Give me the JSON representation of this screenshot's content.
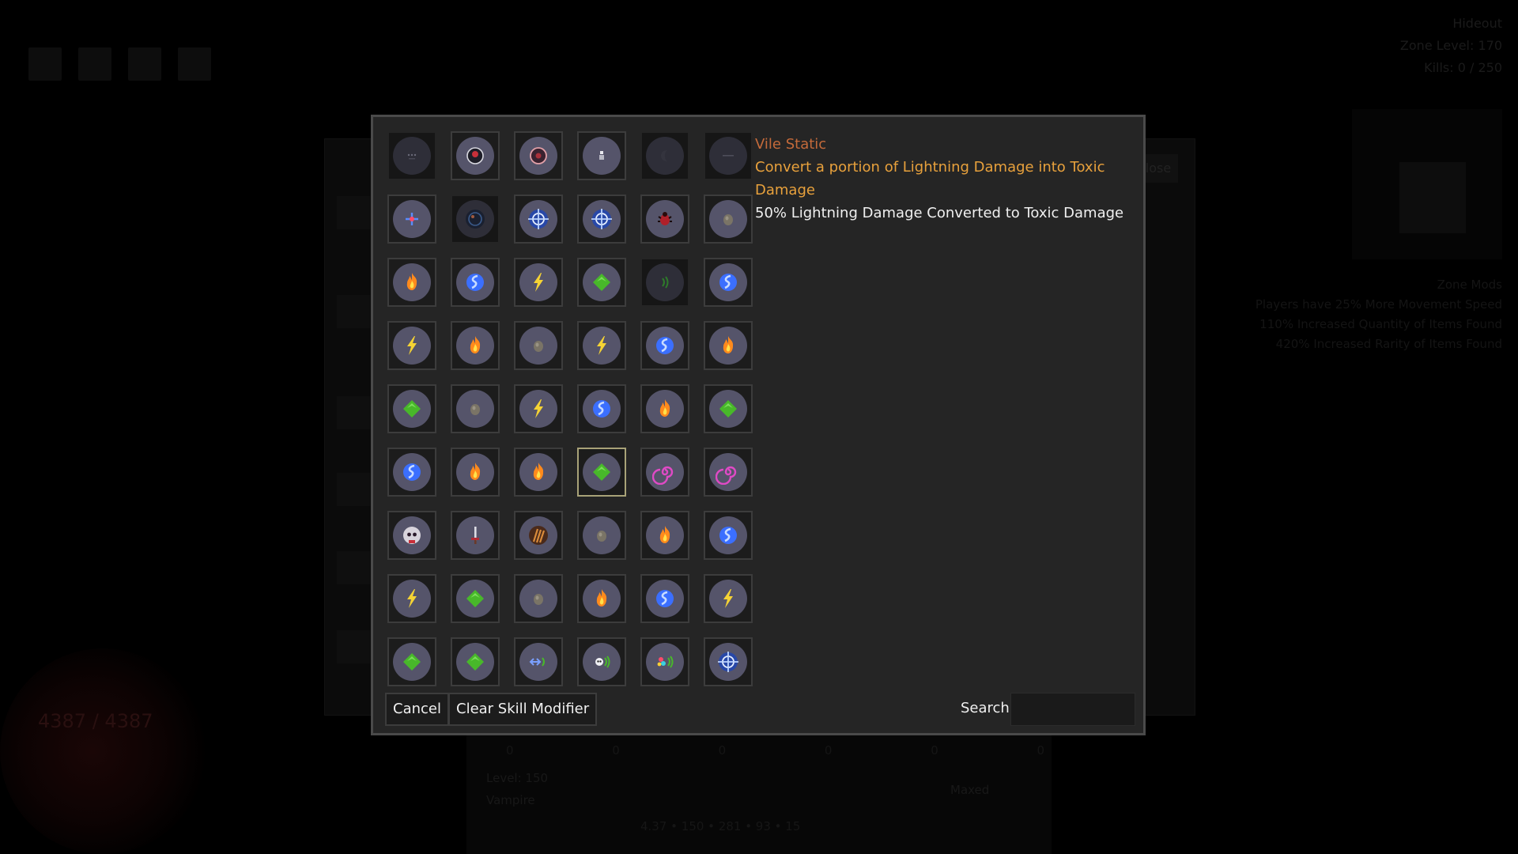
{
  "background": {
    "zone": {
      "name": "Hideout",
      "level": "Zone Level: 170",
      "kills": "Kills: 0 / 250"
    },
    "zone_mods": {
      "title": "Zone Mods",
      "lines": [
        "Players have 25% More Movement Speed",
        "110% Increased Quantity of Items Found",
        "420% Increased Rarity of Items Found"
      ]
    },
    "close_label": "lose",
    "health": "4387 / 4387",
    "bottom_values": "0 0 0 0 0 0",
    "level": "Level: 150",
    "class": "Vampire",
    "maxed": "Maxed",
    "stats": "4.37 • 150 • 281 • 93 • 15"
  },
  "tooltip": {
    "name": "Vile Static",
    "description": "Convert a portion of Lightning Damage into Toxic Damage",
    "effect": "50% Lightning Damage Converted to Toxic Damage"
  },
  "buttons": {
    "cancel": "Cancel",
    "clear": "Clear Skill Modifier"
  },
  "search": {
    "label": "Search",
    "value": ""
  },
  "selected_index": 21,
  "colors": {
    "fire": "#ff8a1c",
    "water": "#3b6fff",
    "lightning": "#f5d334",
    "toxic": "#48b82a",
    "vortex": "#e04ac6",
    "selected_border": "#a8a278",
    "name": "#c46a3a",
    "desc": "#e8a13c"
  },
  "grid": [
    {
      "icon": "small-dots-icon",
      "dim": true
    },
    {
      "icon": "red-ring-icon"
    },
    {
      "icon": "crimson-ring-icon"
    },
    {
      "icon": "tiny-figure-icon"
    },
    {
      "icon": "crescent-icon",
      "dim": true
    },
    {
      "icon": "faint-dots-icon",
      "dim": true
    },
    {
      "icon": "target-cross-icon"
    },
    {
      "icon": "dark-swirl-icon",
      "dim": true
    },
    {
      "icon": "blue-crosshair-icon"
    },
    {
      "icon": "blue-crosshair-icon"
    },
    {
      "icon": "red-bug-icon"
    },
    {
      "icon": "stone-icon"
    },
    {
      "icon": "fire-icon"
    },
    {
      "icon": "water-icon"
    },
    {
      "icon": "lightning-icon"
    },
    {
      "icon": "toxic-icon"
    },
    {
      "icon": "sonic-waves-icon",
      "dim": true
    },
    {
      "icon": "water-icon"
    },
    {
      "icon": "lightning-icon"
    },
    {
      "icon": "fire-icon"
    },
    {
      "icon": "stone-icon"
    },
    {
      "icon": "lightning-icon"
    },
    {
      "icon": "water-icon"
    },
    {
      "icon": "fire-icon"
    },
    {
      "icon": "toxic-icon"
    },
    {
      "icon": "stone-icon"
    },
    {
      "icon": "lightning-icon"
    },
    {
      "icon": "water-icon"
    },
    {
      "icon": "fire-icon"
    },
    {
      "icon": "toxic-icon"
    },
    {
      "icon": "water-icon"
    },
    {
      "icon": "fire-icon"
    },
    {
      "icon": "fire-icon"
    },
    {
      "icon": "toxic-icon",
      "selected": true
    },
    {
      "icon": "vortex-icon"
    },
    {
      "icon": "vortex-icon"
    },
    {
      "icon": "skull-orb-icon"
    },
    {
      "icon": "sword-icon"
    },
    {
      "icon": "claw-icon"
    },
    {
      "icon": "stone-icon"
    },
    {
      "icon": "fire-icon"
    },
    {
      "icon": "water-icon"
    },
    {
      "icon": "lightning-icon"
    },
    {
      "icon": "toxic-icon"
    },
    {
      "icon": "stone-icon"
    },
    {
      "icon": "fire-icon"
    },
    {
      "icon": "water-icon"
    },
    {
      "icon": "lightning-icon"
    },
    {
      "icon": "toxic-icon"
    },
    {
      "icon": "toxic-icon"
    },
    {
      "icon": "arrow-waves-icon"
    },
    {
      "icon": "skull-waves-icon"
    },
    {
      "icon": "multicolor-waves-icon"
    },
    {
      "icon": "blue-crosshair-icon"
    }
  ]
}
